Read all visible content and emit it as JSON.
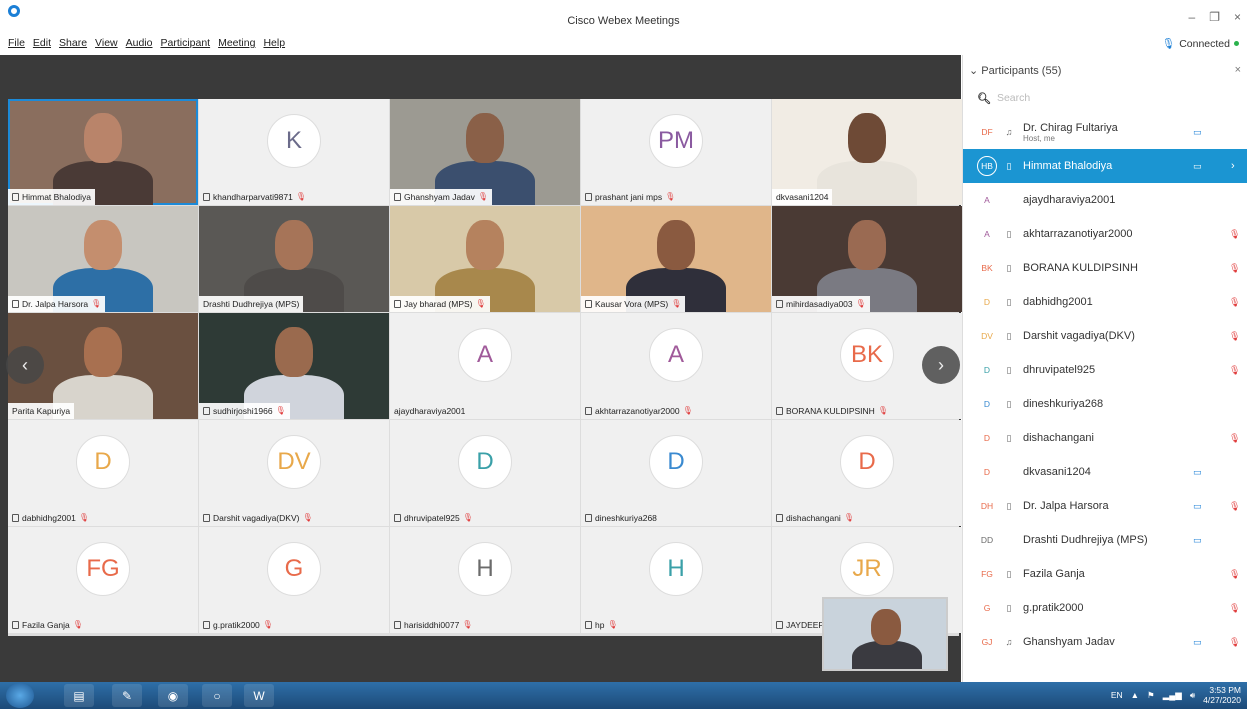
{
  "window": {
    "title": "Cisco Webex Meetings",
    "min": "–",
    "max": "❐",
    "close": "×"
  },
  "menu": [
    "File",
    "Edit",
    "Share",
    "View",
    "Audio",
    "Participant",
    "Meeting",
    "Help"
  ],
  "connection": {
    "label": "Connected"
  },
  "tiles": [
    {
      "kind": "video",
      "label": "Himmat Bhalodiya",
      "device": "screen-icon",
      "muted": false,
      "selected": true,
      "skin": "#b9846a",
      "bg": "#8a6e5e",
      "shirt": "#4a3a36"
    },
    {
      "kind": "avatar",
      "initials": "K",
      "color": "#6b6b8a",
      "label": "khandharparvati9871",
      "device": "phone-icon",
      "muted": true
    },
    {
      "kind": "video",
      "label": "Ghanshyam Jadav",
      "device": "audio-icon",
      "muted": true,
      "skin": "#8a6048",
      "bg": "#9c9a92",
      "shirt": "#3b4f6e"
    },
    {
      "kind": "avatar",
      "initials": "PM",
      "color": "#8a5aa0",
      "label": "prashant jani mps",
      "device": "phone-icon",
      "muted": true
    },
    {
      "kind": "video",
      "label": "dkvasani1204",
      "device": "",
      "muted": false,
      "skin": "#6e4a36",
      "bg": "#f1ece4",
      "shirt": "#e8e4dc"
    },
    {
      "kind": "video",
      "label": "Dr. Jalpa Harsora",
      "device": "phone-icon",
      "muted": true,
      "skin": "#c48e6e",
      "bg": "#c8c6c0",
      "shirt": "#2d6fa6"
    },
    {
      "kind": "video",
      "label": "Drashti Dudhrejiya (MPS)",
      "device": "",
      "muted": false,
      "skin": "#a67458",
      "bg": "#5a5855",
      "shirt": "#4e4b49"
    },
    {
      "kind": "video",
      "label": "Jay bharad (MPS)",
      "device": "phone-icon",
      "muted": true,
      "skin": "#b5825e",
      "bg": "#d8c9a8",
      "shirt": "#a8884c"
    },
    {
      "kind": "video",
      "label": "Kausar Vora (MPS)",
      "device": "phone-icon",
      "muted": true,
      "skin": "#8a5a40",
      "bg": "#e0b68a",
      "shirt": "#2f2f3a"
    },
    {
      "kind": "video",
      "label": "mihirdasadiya003",
      "device": "phone-icon",
      "muted": true,
      "skin": "#9a6a52",
      "bg": "#4a3a34",
      "shirt": "#7a7a82"
    },
    {
      "kind": "video",
      "label": "Parita Kapuriya",
      "device": "",
      "muted": false,
      "skin": "#a87050",
      "bg": "#6a5040",
      "shirt": "#d8d4cc"
    },
    {
      "kind": "video",
      "label": "sudhirjoshi1966",
      "device": "phone-icon",
      "muted": true,
      "skin": "#9a6a4e",
      "bg": "#2e3a36",
      "shirt": "#d0d4dc"
    },
    {
      "kind": "avatar",
      "initials": "A",
      "color": "#a05a9a",
      "label": "ajaydharaviya2001",
      "device": "",
      "muted": false
    },
    {
      "kind": "avatar",
      "initials": "A",
      "color": "#a05a9a",
      "label": "akhtarrazanotiyar2000",
      "device": "phone-icon",
      "muted": true
    },
    {
      "kind": "avatar",
      "initials": "BK",
      "color": "#e86a4a",
      "label": "BORANA KULDIPSINH",
      "device": "phone-icon",
      "muted": true
    },
    {
      "kind": "avatar",
      "initials": "D",
      "color": "#e8a84a",
      "label": "dabhidhg2001",
      "device": "phone-icon",
      "muted": true
    },
    {
      "kind": "avatar",
      "initials": "DV",
      "color": "#e8a84a",
      "label": "Darshit vagadiya(DKV)",
      "device": "phone-icon",
      "muted": true
    },
    {
      "kind": "avatar",
      "initials": "D",
      "color": "#3aa0a8",
      "label": "dhruvipatel925",
      "device": "phone-icon",
      "muted": true
    },
    {
      "kind": "avatar",
      "initials": "D",
      "color": "#3a8ad0",
      "label": "dineshkuriya268",
      "device": "phone-icon",
      "muted": false
    },
    {
      "kind": "avatar",
      "initials": "D",
      "color": "#e86a4a",
      "label": "dishachangani",
      "device": "phone-icon",
      "muted": true
    },
    {
      "kind": "avatar",
      "initials": "FG",
      "color": "#e86a4a",
      "label": "Fazila Ganja",
      "device": "phone-icon",
      "muted": true
    },
    {
      "kind": "avatar",
      "initials": "G",
      "color": "#e86a4a",
      "label": "g.pratik2000",
      "device": "phone-icon",
      "muted": true
    },
    {
      "kind": "avatar",
      "initials": "H",
      "color": "#6b6b6b",
      "label": "harisiddhi0077",
      "device": "phone-icon",
      "muted": true
    },
    {
      "kind": "avatar",
      "initials": "H",
      "color": "#3aa0a8",
      "label": "hp",
      "device": "phone-icon",
      "muted": true
    },
    {
      "kind": "avatar",
      "initials": "JR",
      "color": "#e8a84a",
      "label": "JAYDEEP",
      "device": "phone-icon",
      "muted": true
    }
  ],
  "panel": {
    "title": "Participants (55)",
    "search_placeholder": "Search",
    "participants": [
      {
        "initials": "DF",
        "color": "#e86a4a",
        "name": "Dr. Chirag Fultariya",
        "sub": "Host, me",
        "device": "audio-icon",
        "cam": true,
        "muted": false
      },
      {
        "initials": "HB",
        "color": "#1b95d2",
        "name": "Himmat Bhalodiya",
        "sub": "",
        "device": "phone-icon",
        "cam": true,
        "muted": false,
        "active": true
      },
      {
        "initials": "A",
        "color": "#a05a9a",
        "name": "ajaydharaviya2001",
        "sub": "",
        "device": "",
        "cam": false,
        "muted": false
      },
      {
        "initials": "A",
        "color": "#a05a9a",
        "name": "akhtarrazanotiyar2000",
        "sub": "",
        "device": "phone-icon",
        "cam": false,
        "muted": true
      },
      {
        "initials": "BK",
        "color": "#e86a4a",
        "name": "BORANA KULDIPSINH",
        "sub": "",
        "device": "phone-icon",
        "cam": false,
        "muted": true
      },
      {
        "initials": "D",
        "color": "#e8a84a",
        "name": "dabhidhg2001",
        "sub": "",
        "device": "phone-icon",
        "cam": false,
        "muted": true
      },
      {
        "initials": "DV",
        "color": "#e8a84a",
        "name": "Darshit vagadiya(DKV)",
        "sub": "",
        "device": "phone-icon",
        "cam": false,
        "muted": true
      },
      {
        "initials": "D",
        "color": "#3aa0a8",
        "name": "dhruvipatel925",
        "sub": "",
        "device": "phone-icon",
        "cam": false,
        "muted": true
      },
      {
        "initials": "D",
        "color": "#3a8ad0",
        "name": "dineshkuriya268",
        "sub": "",
        "device": "phone-icon",
        "cam": false,
        "muted": false
      },
      {
        "initials": "D",
        "color": "#e86a4a",
        "name": "dishachangani",
        "sub": "",
        "device": "phone-icon",
        "cam": false,
        "muted": true
      },
      {
        "initials": "D",
        "color": "#e86a4a",
        "name": "dkvasani1204",
        "sub": "",
        "device": "",
        "cam": true,
        "muted": false
      },
      {
        "initials": "DH",
        "color": "#e86a4a",
        "name": "Dr. Jalpa Harsora",
        "sub": "",
        "device": "phone-icon",
        "cam": true,
        "muted": true
      },
      {
        "initials": "DD",
        "color": "#6b6b6b",
        "name": "Drashti Dudhrejiya (MPS)",
        "sub": "",
        "device": "",
        "cam": true,
        "muted": false
      },
      {
        "initials": "FG",
        "color": "#e86a4a",
        "name": "Fazila Ganja",
        "sub": "",
        "device": "phone-icon",
        "cam": false,
        "muted": true
      },
      {
        "initials": "G",
        "color": "#e86a4a",
        "name": "g.pratik2000",
        "sub": "",
        "device": "phone-icon",
        "cam": false,
        "muted": true
      },
      {
        "initials": "GJ",
        "color": "#e86a4a",
        "name": "Ghanshyam Jadav",
        "sub": "",
        "device": "audio-icon",
        "cam": true,
        "muted": true
      }
    ]
  },
  "taskbar": {
    "lang": "EN",
    "time": "3:53 PM",
    "date": "4/27/2020",
    "apps": [
      "explorer-icon",
      "paint-icon",
      "chrome-icon",
      "webex-icon",
      "word-icon"
    ]
  }
}
